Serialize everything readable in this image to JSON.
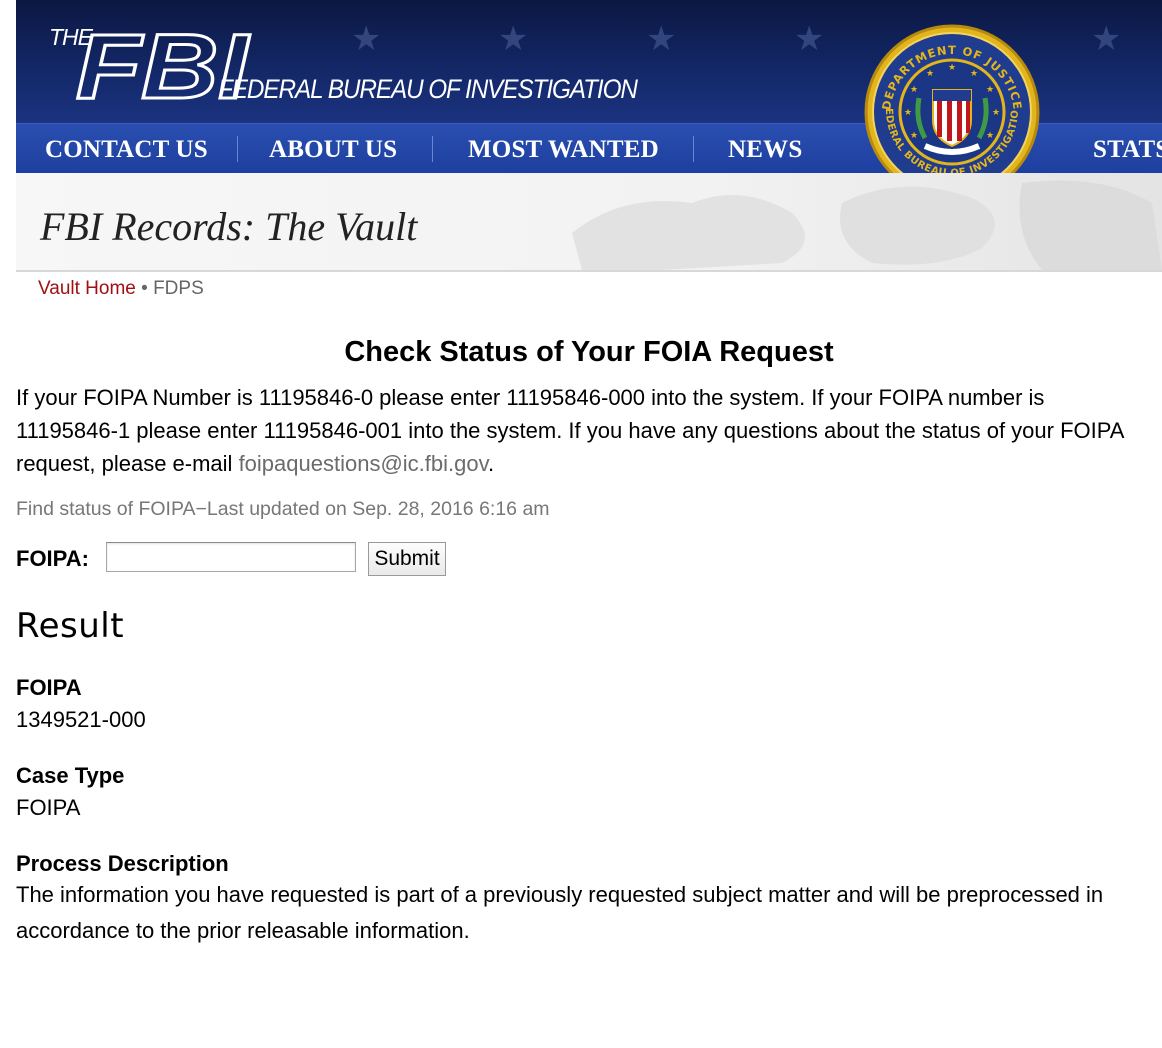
{
  "banner": {
    "logo_the": "THE",
    "logo_fbi": "FBI",
    "logo_name": "FEDERAL BUREAU OF INVESTIGATION",
    "nav": [
      "CONTACT US",
      "ABOUT US",
      "MOST WANTED",
      "NEWS",
      "STATS"
    ],
    "seal": {
      "top_text": "DEPARTMENT OF JUSTICE",
      "bottom_text": "FEDERAL BUREAU OF INVESTIGATION"
    }
  },
  "vault": {
    "title": "FBI Records: The Vault"
  },
  "breadcrumb": {
    "home": "Vault Home",
    "separator": "•",
    "current": "FDPS"
  },
  "main": {
    "title": "Check Status of Your FOIA Request",
    "intro_text": "If your FOIPA Number is 11195846-0 please enter 11195846-000 into the system. If your FOIPA number is 11195846-1 please enter 11195846-001 into the system. If you have any questions about the status of your FOIPA request, please e-mail ",
    "intro_email": "foipaquestions@ic.fbi.gov",
    "intro_end": ".",
    "last_updated": "Find status of FOIPA−Last updated on Sep. 28, 2016 6:16 am",
    "form": {
      "label": "FOIPA:",
      "input_value": "",
      "submit_label": "Submit"
    }
  },
  "result": {
    "heading": "Result",
    "foipa_label": "FOIPA",
    "foipa_value": "1349521-000",
    "case_type_label": "Case Type",
    "case_type_value": "FOIPA",
    "process_label": "Process Description",
    "process_value": "The information you have requested is part of a previously requested subject matter and will be preprocessed in accordance to the prior releasable information."
  },
  "colors": {
    "banner_dark": "#0b1842",
    "nav_blue": "#1d3f9f",
    "link_red": "#a10f13",
    "seal_gold": "#e3b51c"
  }
}
